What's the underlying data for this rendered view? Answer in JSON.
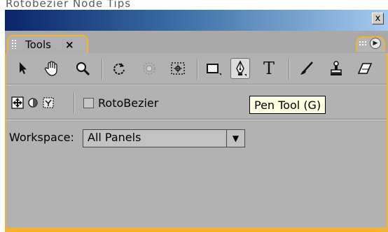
{
  "window": {
    "cutoff_title": "Rotobezier Node Tips",
    "close_glyph": "x"
  },
  "panel": {
    "tab_label": "Tools",
    "tab_close": "×",
    "menu_glyph": "▶"
  },
  "toolbar": {
    "tools": [
      {
        "name": "selection-tool",
        "icon": "arrow-pointer"
      },
      {
        "name": "hand-tool",
        "icon": "hand"
      },
      {
        "name": "zoom-tool",
        "icon": "magnifier"
      },
      {
        "name": "rotation-tool",
        "icon": "rotate-arrow"
      },
      {
        "name": "orbit-camera-tool",
        "icon": "orbit"
      },
      {
        "name": "pan-behind-tool",
        "icon": "pan-behind"
      },
      {
        "name": "rectangle-tool",
        "icon": "rectangle"
      },
      {
        "name": "pen-tool",
        "icon": "pen-nib",
        "active": true
      },
      {
        "name": "type-tool",
        "icon": "letter-T"
      },
      {
        "name": "brush-tool",
        "icon": "brush"
      },
      {
        "name": "clone-stamp-tool",
        "icon": "stamp"
      },
      {
        "name": "eraser-tool",
        "icon": "eraser"
      }
    ],
    "type_tool_glyph": "T"
  },
  "tooltip": {
    "text": "Pen Tool (G)"
  },
  "options": {
    "rotobezier_label": "RotoBezier",
    "rotobezier_checked": false
  },
  "workspace": {
    "label": "Workspace:",
    "selected": "All Panels",
    "arrow": "▼"
  },
  "colors": {
    "panel_bg": "#b2b2b2",
    "highlight_frame": "#f5b331",
    "tooltip_bg": "#ffffe1",
    "title_gradient_start": "#0a246a"
  }
}
